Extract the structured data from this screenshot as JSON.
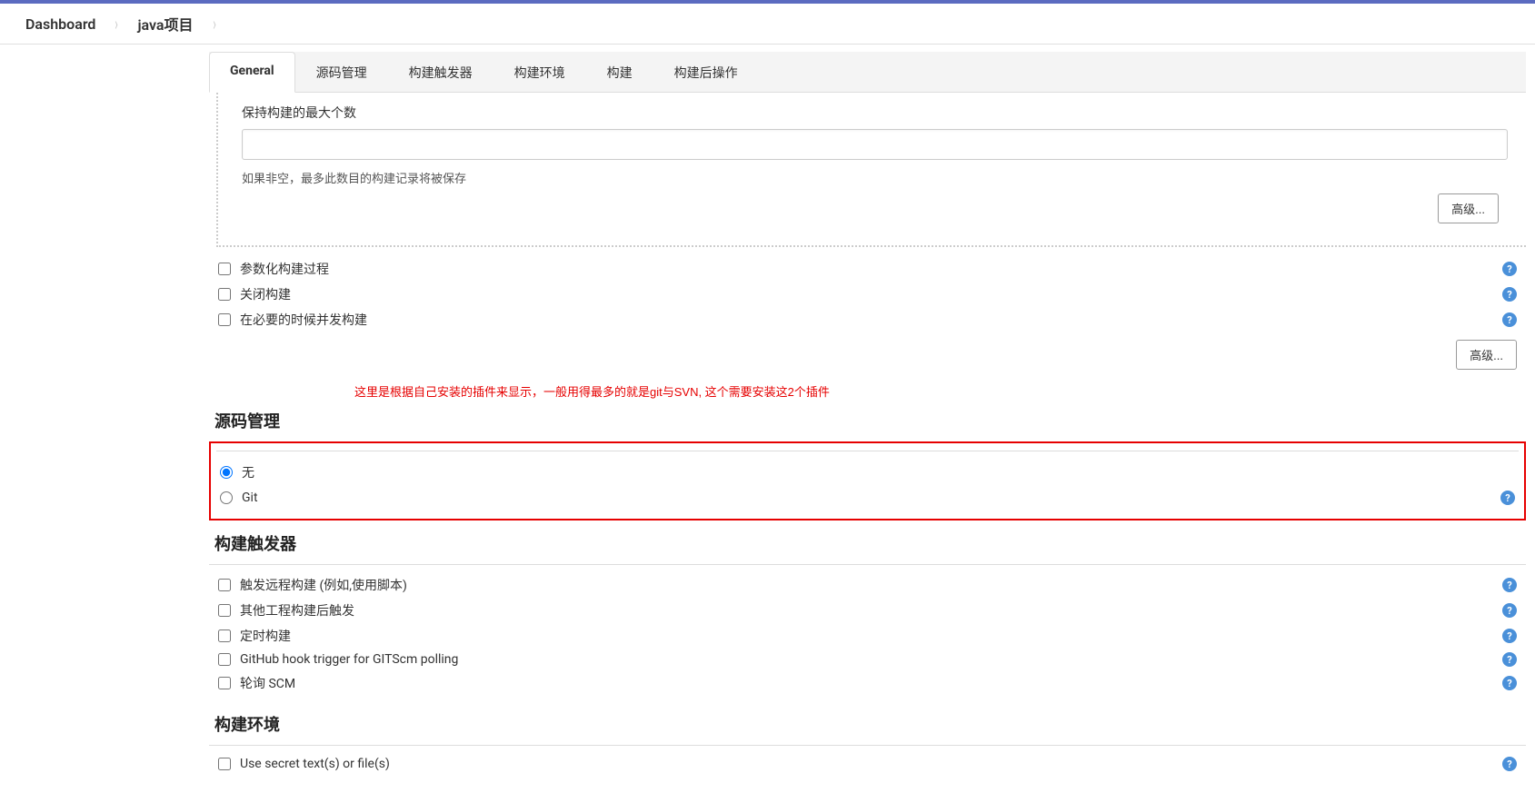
{
  "breadcrumb": {
    "items": [
      "Dashboard",
      "java项目"
    ]
  },
  "tabs": [
    {
      "label": "General",
      "active": true
    },
    {
      "label": "源码管理",
      "active": false
    },
    {
      "label": "构建触发器",
      "active": false
    },
    {
      "label": "构建环境",
      "active": false
    },
    {
      "label": "构建",
      "active": false
    },
    {
      "label": "构建后操作",
      "active": false
    }
  ],
  "general": {
    "maxBuildsLabel": "保持构建的最大个数",
    "maxBuildsValue": "",
    "maxBuildsHelp": "如果非空，最多此数目的构建记录将被保存",
    "advancedBtn": "高级...",
    "checkboxes": [
      {
        "label": "参数化构建过程",
        "checked": false,
        "help": true
      },
      {
        "label": "关闭构建",
        "checked": false,
        "help": true
      },
      {
        "label": "在必要的时候并发构建",
        "checked": false,
        "help": true
      }
    ]
  },
  "annotation": "这里是根据自己安装的插件来显示，一般用得最多的就是git与SVN, 这个需要安装这2个插件",
  "scm": {
    "title": "源码管理",
    "options": [
      {
        "label": "无",
        "checked": true,
        "help": false
      },
      {
        "label": "Git",
        "checked": false,
        "help": true
      }
    ]
  },
  "triggers": {
    "title": "构建触发器",
    "items": [
      {
        "label": "触发远程构建 (例如,使用脚本)",
        "checked": false
      },
      {
        "label": "其他工程构建后触发",
        "checked": false
      },
      {
        "label": "定时构建",
        "checked": false
      },
      {
        "label": "GitHub hook trigger for GITScm polling",
        "checked": false
      },
      {
        "label": "轮询 SCM",
        "checked": false
      }
    ]
  },
  "buildEnv": {
    "title": "构建环境",
    "items": [
      {
        "label": "Use secret text(s) or file(s)",
        "checked": false
      }
    ]
  }
}
